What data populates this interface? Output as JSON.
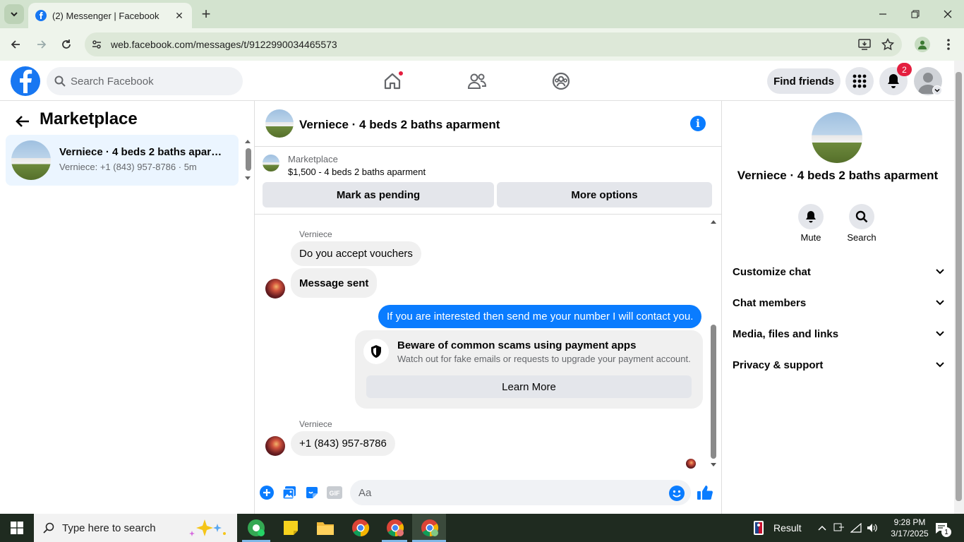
{
  "browser": {
    "tab_title": "(2) Messenger | Facebook",
    "url": "web.facebook.com/messages/t/9122990034465573"
  },
  "fb": {
    "search_placeholder": "Search Facebook",
    "find_friends": "Find friends",
    "notification_count": "2"
  },
  "left": {
    "title": "Marketplace",
    "conversation": {
      "name": "Verniece · 4 beds 2 baths aparm...",
      "subtitle": "Verniece: +1 (843) 957-8786 · 5m"
    }
  },
  "chat": {
    "title": "Verniece · 4 beds 2 baths aparment",
    "marketplace_label": "Marketplace",
    "listing": "$1,500 - 4 beds 2 baths aparment",
    "mark_pending": "Mark as pending",
    "more_options": "More options",
    "messages": [
      {
        "sender": "Verniece",
        "text": "Do you accept vouchers"
      },
      {
        "text": "Message sent"
      },
      {
        "text": "If you are interested then send me your number I will contact you."
      },
      {
        "sender": "Verniece",
        "text": "+1 (843) 957-8786"
      }
    ],
    "scam_notice": {
      "title": "Beware of common scams using payment apps",
      "body": "Watch out for fake emails or requests to upgrade your payment account.",
      "button": "Learn More"
    },
    "composer_placeholder": "Aa"
  },
  "right": {
    "title": "Verniece · 4 beds 2 baths aparment",
    "mute": "Mute",
    "search": "Search",
    "sections": [
      "Customize chat",
      "Chat members",
      "Media, files and links",
      "Privacy & support"
    ]
  },
  "taskbar": {
    "search_placeholder": "Type here to search",
    "widget": "Result",
    "time": "9:28 PM",
    "date": "3/17/2025",
    "notif_count": "1"
  },
  "colors": {
    "fb_blue": "#1877f2",
    "messenger_blue": "#0a7cff",
    "badge_red": "#e41e3f"
  }
}
